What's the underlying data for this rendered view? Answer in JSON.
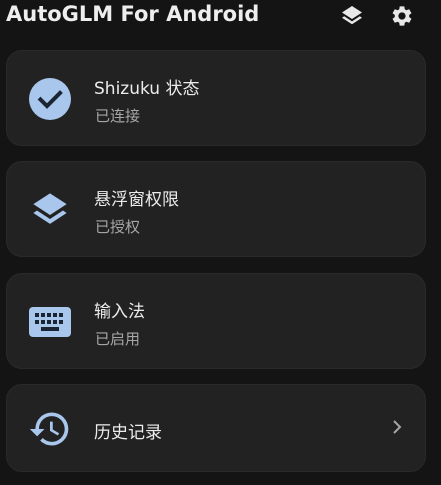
{
  "header": {
    "title": "AutoGLM For Android",
    "layers_icon": "layers-icon",
    "settings_icon": "gear-icon"
  },
  "cards": [
    {
      "title": "Shizuku 状态",
      "subtitle": "已连接",
      "icon": "check-circle-icon"
    },
    {
      "title": "悬浮窗权限",
      "subtitle": "已授权",
      "icon": "layers-icon"
    },
    {
      "title": "输入法",
      "subtitle": "已启用",
      "icon": "keyboard-icon"
    },
    {
      "title": "历史记录",
      "icon": "history-icon",
      "chevron": "chevron-right-icon"
    }
  ],
  "colors": {
    "background": "#141414",
    "card": "#222222",
    "accent": "#a9c6ec",
    "icon_dark": "#1a2433"
  }
}
